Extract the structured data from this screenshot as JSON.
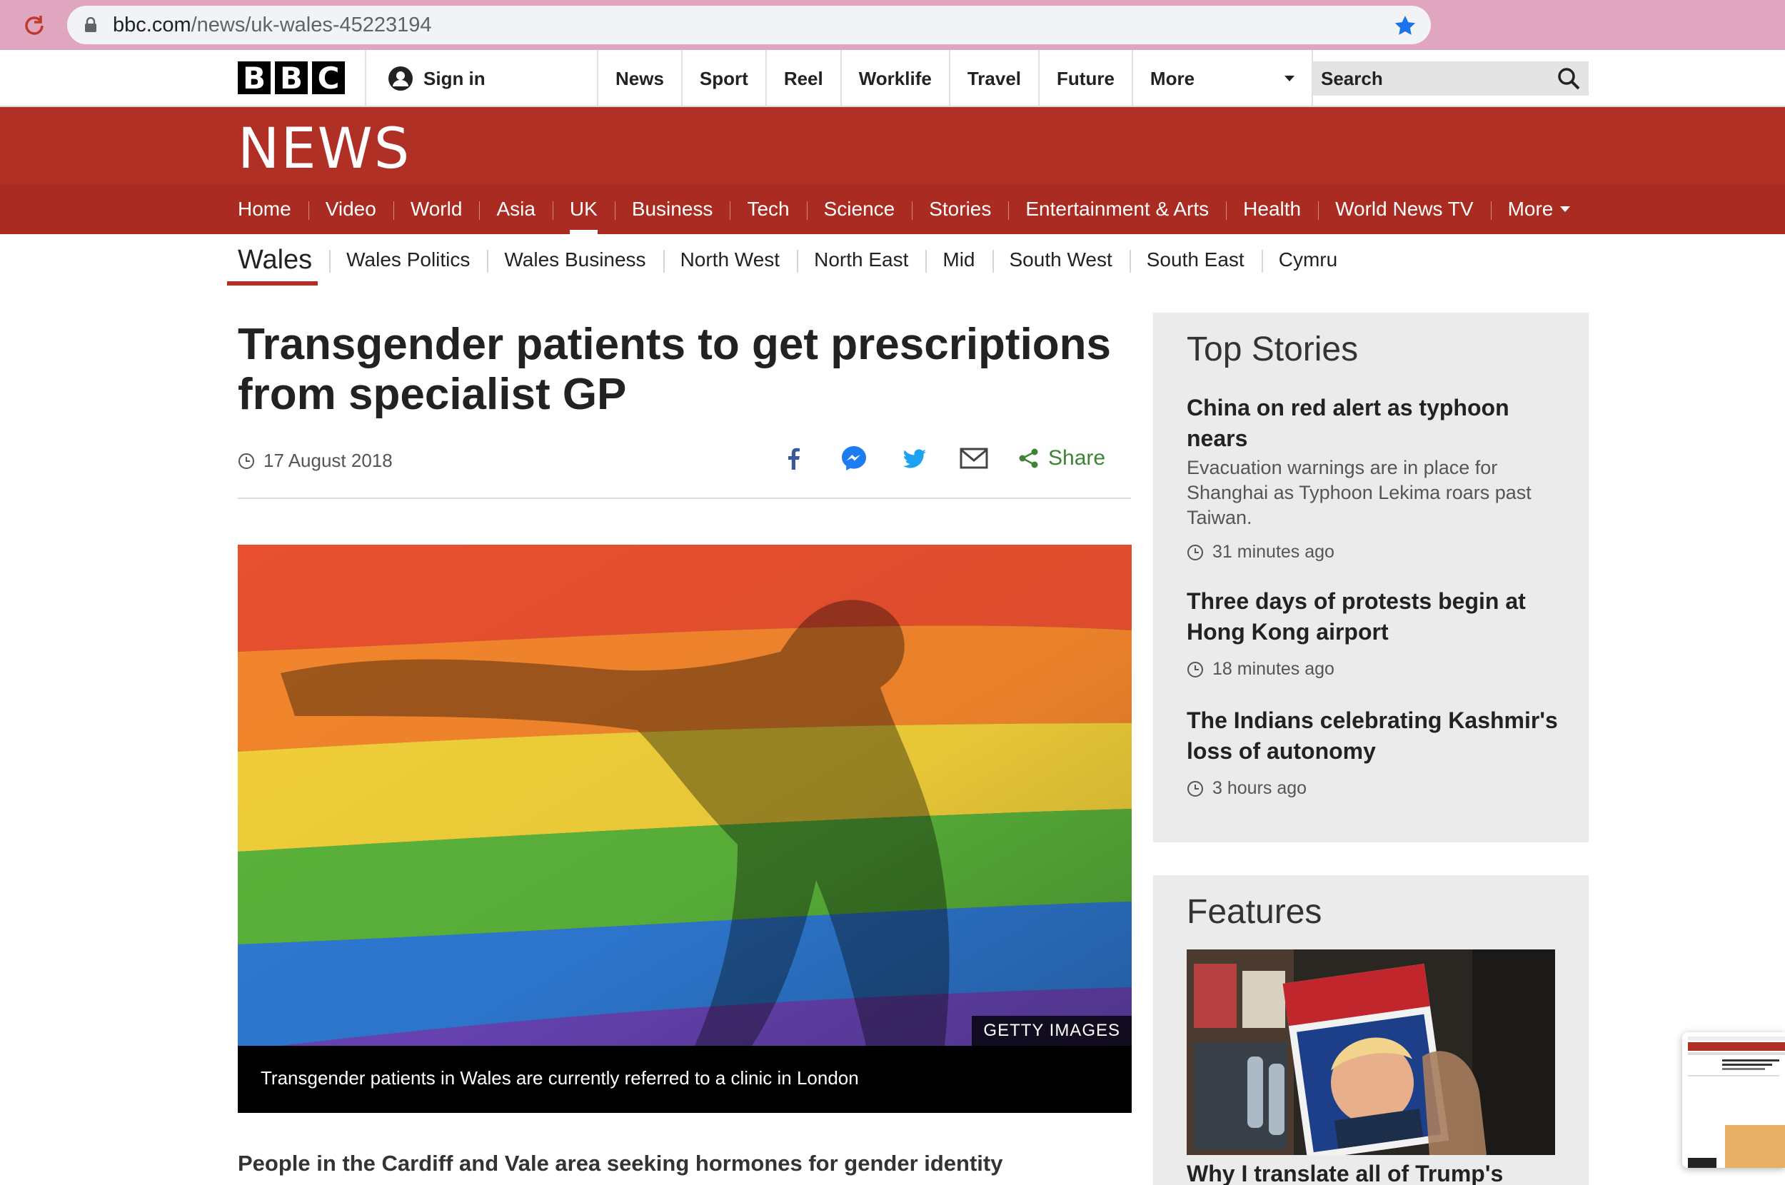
{
  "browser": {
    "url_host": "bbc.com",
    "url_path": "/news/uk-wales-45223194"
  },
  "global_nav": {
    "logo_letters": [
      "B",
      "B",
      "C"
    ],
    "signin": "Sign in",
    "items": [
      "News",
      "Sport",
      "Reel",
      "Worklife",
      "Travel",
      "Future"
    ],
    "more": "More",
    "search_label": "Search"
  },
  "news_banner": {
    "title": "NEWS"
  },
  "section_nav": {
    "items": [
      "Home",
      "Video",
      "World",
      "Asia",
      "UK",
      "Business",
      "Tech",
      "Science",
      "Stories",
      "Entertainment & Arts",
      "Health",
      "World News TV",
      "More"
    ],
    "active": "UK"
  },
  "sub_nav": {
    "region": "Wales",
    "items": [
      "Wales Politics",
      "Wales Business",
      "North West",
      "North East",
      "Mid",
      "South West",
      "South East",
      "Cymru"
    ]
  },
  "article": {
    "headline": "Transgender patients to get prescriptions from specialist GP",
    "date": "17 August 2018",
    "share_label": "Share",
    "image_credit": "GETTY IMAGES",
    "image_caption": "Transgender patients in Wales are currently referred to a clinic in London",
    "intro": "People in the Cardiff and Vale area seeking hormones for gender identity"
  },
  "top_stories": {
    "title": "Top Stories",
    "items": [
      {
        "title": "China on red alert as typhoon nears",
        "summary": "Evacuation warnings are in place for Shanghai as Typhoon Lekima roars past Taiwan.",
        "time": "31 minutes ago"
      },
      {
        "title": "Three days of protests begin at Hong Kong airport",
        "summary": "",
        "time": "18 minutes ago"
      },
      {
        "title": "The Indians celebrating Kashmir's loss of autonomy",
        "summary": "",
        "time": "3 hours ago"
      }
    ]
  },
  "features": {
    "title": "Features",
    "item_title": "Why I translate all of Trump's"
  },
  "colors": {
    "bbc_red": "#b03026",
    "section_red": "#a92b21",
    "share_green": "#3d8534",
    "chrome_bar": "#e1a6bf"
  },
  "icons": [
    "reload-icon",
    "lock-icon",
    "bookmark-star-icon",
    "user-icon",
    "search-icon",
    "clock-icon",
    "facebook-icon",
    "messenger-icon",
    "twitter-icon",
    "email-icon",
    "share-icon"
  ]
}
